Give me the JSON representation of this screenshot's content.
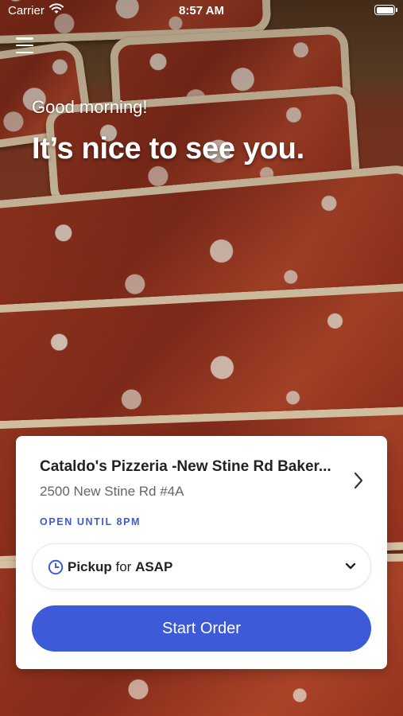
{
  "status_bar": {
    "carrier": "Carrier",
    "time": "8:57 AM",
    "icons": [
      "wifi-icon",
      "battery-icon"
    ]
  },
  "header": {
    "menu_icon": "hamburger-menu-icon",
    "greeting": "Good morning!",
    "headline": "It’s nice to see you."
  },
  "location_card": {
    "name": "Cataldo's Pizzeria -New Stine Rd Baker...",
    "address": "2500 New Stine Rd #4A",
    "hours_status": "OPEN UNTIL 8PM",
    "pickup": {
      "mode": "Pickup",
      "connector": "for",
      "time": "ASAP"
    },
    "start_button_label": "Start Order"
  },
  "colors": {
    "accent": "#3d5ad9",
    "card_bg": "#ffffff",
    "text_primary": "#222222",
    "text_secondary": "#666666"
  }
}
